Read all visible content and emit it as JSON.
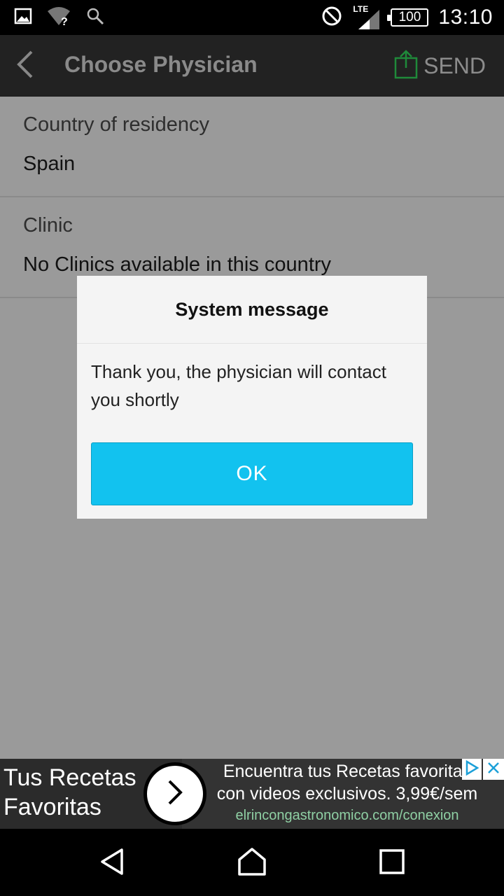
{
  "status_bar": {
    "time": "13:10",
    "battery": "100",
    "network": "LTE",
    "icons": [
      "image-icon",
      "wifi-unknown-icon",
      "search-icon",
      "do-not-disturb-icon",
      "signal-icon",
      "battery-icon"
    ]
  },
  "app_bar": {
    "title": "Choose Physician",
    "send_label": "SEND"
  },
  "form": {
    "country_label": "Country of residency",
    "country_value": "Spain",
    "clinic_label": "Clinic",
    "clinic_value": "No Clinics available in this country"
  },
  "dialog": {
    "title": "System message",
    "message": "Thank you, the physician will contact you shortly",
    "ok_label": "OK"
  },
  "ad": {
    "headline": "Tus Recetas Favoritas",
    "line1": "Encuentra tus Recetas favoritas",
    "line2": "con videos exclusivos. 3,99€/sem",
    "url": "elrincongastronomico.com/conexion"
  },
  "colors": {
    "accent": "#12c2ef",
    "send_icon": "#1f8a3a",
    "overlay_background": "#9a9a9a"
  }
}
